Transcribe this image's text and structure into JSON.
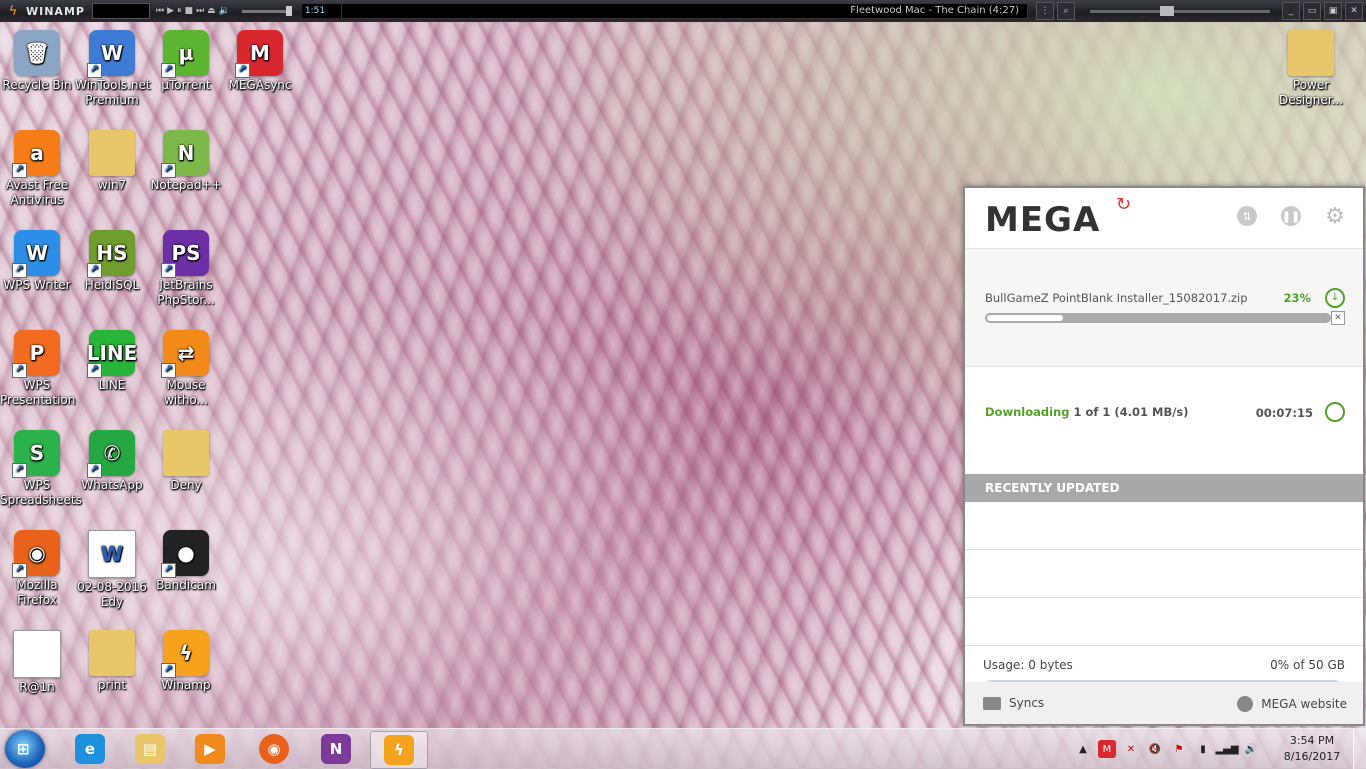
{
  "winamp": {
    "title": "WINAMP",
    "time": "1:51",
    "track": "Fleetwood Mac - The Chain (4:27)"
  },
  "desktop": {
    "icons": [
      {
        "label": "Recycle Bin",
        "color": "#8aa6c4",
        "glyph": "🗑"
      },
      {
        "label": "WinTools.net Premium",
        "color": "#3d7bd6",
        "glyph": "W"
      },
      {
        "label": "µTorrent",
        "color": "#5cb531",
        "glyph": "µ"
      },
      {
        "label": "MEGAsync",
        "color": "#d9272e",
        "glyph": "M"
      },
      {
        "label": "Avast Free Antivirus",
        "color": "#f57c16",
        "glyph": "a"
      },
      {
        "label": "win7",
        "color": "#e8c66a",
        "glyph": ""
      },
      {
        "label": "Notepad++",
        "color": "#7eb84a",
        "glyph": "N"
      },
      {
        "label": "WPS Writer",
        "color": "#2d8ee8",
        "glyph": "W"
      },
      {
        "label": "HeidiSQL",
        "color": "#6f9e2e",
        "glyph": "HS"
      },
      {
        "label": "JetBrains PhpStor...",
        "color": "#6d2fa6",
        "glyph": "PS"
      },
      {
        "label": "WPS Presentation",
        "color": "#f26b21",
        "glyph": "P"
      },
      {
        "label": "LINE",
        "color": "#29b43a",
        "glyph": "LINE"
      },
      {
        "label": "Mouse witho...",
        "color": "#f28a1a",
        "glyph": "⇄"
      },
      {
        "label": "WPS Spreadsheets",
        "color": "#2bb24c",
        "glyph": "S"
      },
      {
        "label": "WhatsApp",
        "color": "#25a843",
        "glyph": "✆"
      },
      {
        "label": "Deny",
        "color": "#e8c66a",
        "glyph": ""
      },
      {
        "label": "Mozilla Firefox",
        "color": "#e8621c",
        "glyph": "◉"
      },
      {
        "label": "02-08-2016 Edy",
        "color": "#ffffff",
        "glyph": "W"
      },
      {
        "label": "Bandicam",
        "color": "#222222",
        "glyph": "●"
      },
      {
        "label": "R@1n",
        "color": "#ffffff",
        "glyph": ""
      },
      {
        "label": "print",
        "color": "#e8c66a",
        "glyph": ""
      },
      {
        "label": "Winamp",
        "color": "#f6a21d",
        "glyph": "ϟ"
      },
      {
        "label": "Power Designer...",
        "color": "#e8c66a",
        "glyph": ""
      }
    ]
  },
  "mega": {
    "brand": "MEGA",
    "transfer": {
      "filename": "BullGameZ PointBlank Installer_15082017.zip",
      "percent_label": "23%",
      "progress": 0.23
    },
    "status": {
      "state": "Downloading",
      "detail": "1 of 1 (4.01 MB/s)",
      "eta": "00:07:15"
    },
    "recently_updated": "RECENTLY UPDATED",
    "usage": {
      "label": "Usage: 0 bytes",
      "quota": "0% of 50 GB",
      "fraction": 0.0
    },
    "footer": {
      "syncs": "Syncs",
      "website": "MEGA website"
    }
  },
  "taskbar": {
    "apps": [
      "Internet Explorer",
      "Windows Explorer",
      "Windows Media Player",
      "Firefox",
      "OneNote",
      "Winamp"
    ],
    "clock_time": "3:54 PM",
    "clock_date": "8/16/2017"
  }
}
